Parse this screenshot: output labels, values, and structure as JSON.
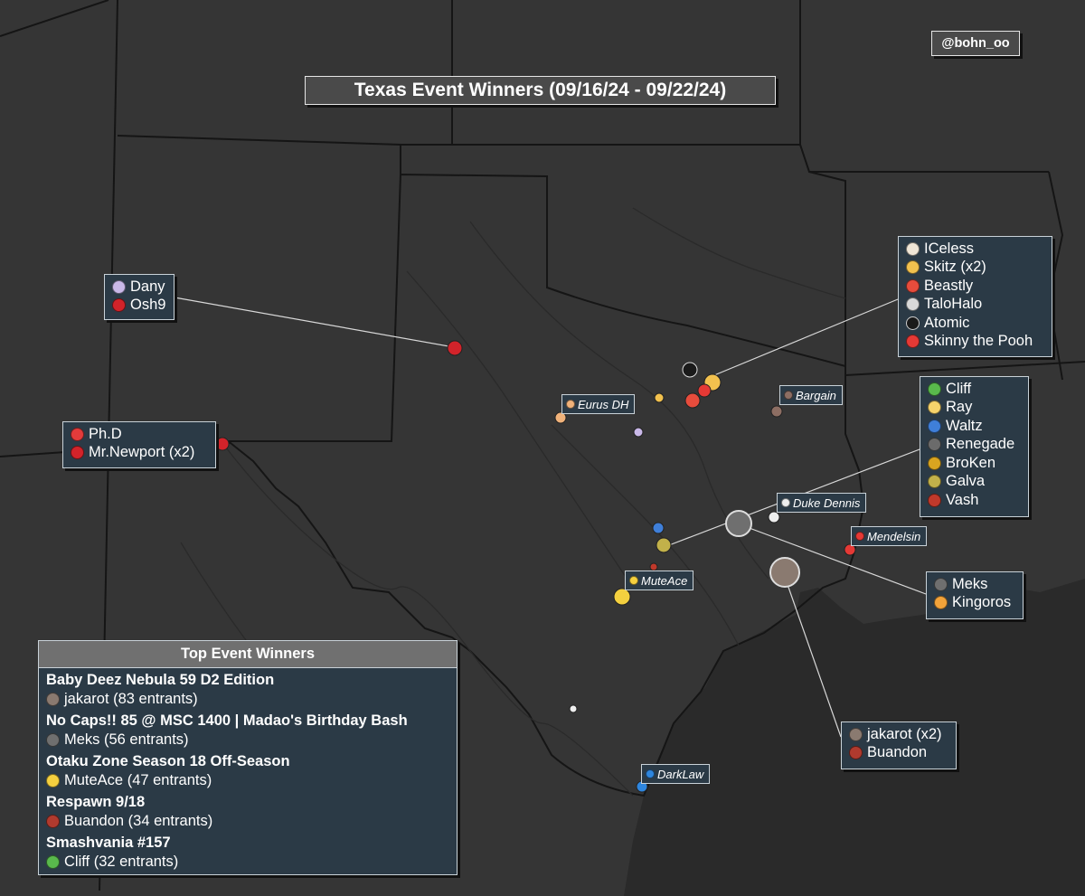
{
  "title": "Texas Event Winners (09/16/24 - 09/22/24)",
  "credit": "@bohn_oo",
  "colors": {
    "land": "#353535",
    "water": "#2b2b2b",
    "box_bg": "#2b3a46",
    "box_border": "#c9d2d8",
    "red_marker": "#d2232a",
    "title_bg": "#4a4a4a"
  },
  "clusters": [
    {
      "id": "amarillo",
      "players": [
        {
          "name": "Dany",
          "icon": "dany-icon",
          "color": "#c9b8e8"
        },
        {
          "name": "Osh9",
          "icon": "osh9-icon",
          "color": "#d2232a"
        }
      ]
    },
    {
      "id": "elpaso",
      "players": [
        {
          "name": "Ph.D",
          "icon": "phd-icon",
          "color": "#e23b3b"
        },
        {
          "name": "Mr.Newport (x2)",
          "icon": "mrnewport-icon",
          "color": "#d2232a"
        }
      ]
    },
    {
      "id": "dfw",
      "players": [
        {
          "name": "ICeless",
          "icon": "iceless-icon",
          "color": "#f0e6d6"
        },
        {
          "name": "Skitz (x2)",
          "icon": "skitz-icon",
          "color": "#f2c14e"
        },
        {
          "name": "Beastly",
          "icon": "beastly-icon",
          "color": "#e74c3c"
        },
        {
          "name": "TaloHalo",
          "icon": "talohalo-icon",
          "color": "#d9d9d9"
        },
        {
          "name": "Atomic",
          "icon": "atomic-icon",
          "color": "#1a1a1a"
        },
        {
          "name": "Skinny the Pooh",
          "icon": "skinny-icon",
          "color": "#e53935"
        }
      ]
    },
    {
      "id": "austin",
      "players": [
        {
          "name": "Cliff",
          "icon": "cliff-icon",
          "color": "#59b94c"
        },
        {
          "name": "Ray",
          "icon": "ray-icon",
          "color": "#f6d36b"
        },
        {
          "name": "Waltz",
          "icon": "waltz-icon",
          "color": "#3f7fd9"
        },
        {
          "name": "Renegade",
          "icon": "renegade-icon",
          "color": "#6b6b6b"
        },
        {
          "name": "BroKen",
          "icon": "broken-icon",
          "color": "#d9a520"
        },
        {
          "name": "Galva",
          "icon": "galva-icon",
          "color": "#c2b14a"
        },
        {
          "name": "Vash",
          "icon": "vash-icon",
          "color": "#c0392b"
        }
      ]
    },
    {
      "id": "bcs",
      "players": [
        {
          "name": "Meks",
          "icon": "meks-icon",
          "color": "#6f6f6f"
        },
        {
          "name": "Kingoros",
          "icon": "kingoros-icon",
          "color": "#f2a33a"
        }
      ]
    },
    {
      "id": "houston",
      "players": [
        {
          "name": "jakarot (x2)",
          "icon": "jakarot-icon",
          "color": "#8a7a70"
        },
        {
          "name": "Buandon",
          "icon": "buandon-icon",
          "color": "#b03a2e"
        }
      ]
    }
  ],
  "tags": [
    {
      "id": "eurus",
      "name": "Eurus DH",
      "icon": "eurus-icon",
      "color": "#f0b27a"
    },
    {
      "id": "bargain",
      "name": "Bargain",
      "icon": "bargain-icon",
      "color": "#8d6e63"
    },
    {
      "id": "duke",
      "name": "Duke Dennis",
      "icon": "duke-icon",
      "color": "#eeeeee"
    },
    {
      "id": "mendelsin",
      "name": "Mendelsin",
      "icon": "mendelsin-icon",
      "color": "#e53935"
    },
    {
      "id": "muteace",
      "name": "MuteAce",
      "icon": "muteace-icon",
      "color": "#f4d03f"
    },
    {
      "id": "darklaw",
      "name": "DarkLaw",
      "icon": "darklaw-icon",
      "color": "#2e86de"
    }
  ],
  "top_events": {
    "header": "Top Event Winners",
    "events": [
      {
        "name": "Baby Deez Nebula 59 D2 Edition",
        "winner": "jakarot (83 entrants)",
        "icon": "jakarot-icon",
        "color": "#8a7a70"
      },
      {
        "name": "No Caps!! 85 @ MSC 1400 | Madao's Birthday Bash",
        "winner": "Meks (56 entrants)",
        "icon": "meks-icon",
        "color": "#6f6f6f"
      },
      {
        "name": "Otaku Zone Season 18 Off-Season",
        "winner": "MuteAce (47 entrants)",
        "icon": "muteace-icon",
        "color": "#f4d03f"
      },
      {
        "name": "Respawn 9/18",
        "winner": "Buandon (34 entrants)",
        "icon": "buandon-icon",
        "color": "#b03a2e"
      },
      {
        "name": "Smashvania #157",
        "winner": "Cliff (32 entrants)",
        "icon": "cliff-icon",
        "color": "#59b94c"
      }
    ]
  }
}
